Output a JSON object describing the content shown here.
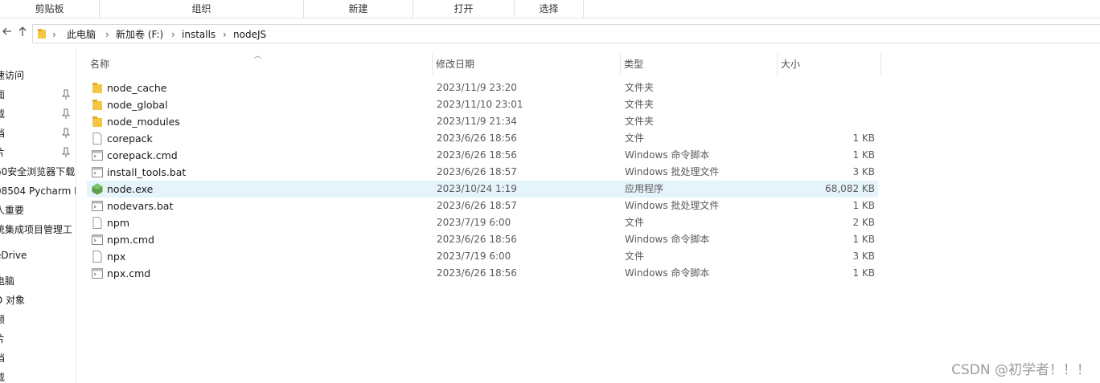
{
  "ribbon": {
    "groups": [
      "剪贴板",
      "组织",
      "新建",
      "打开",
      "选择"
    ]
  },
  "nav": {
    "back_icon": "arrow-left-icon",
    "up_icon": "arrow-up-icon"
  },
  "address": {
    "crumbs": [
      "此电脑",
      "新加卷 (F:)",
      "installs",
      "nodeJS"
    ]
  },
  "sidebar": {
    "items": [
      {
        "label": "速访问",
        "pinned": false
      },
      {
        "label": "面",
        "pinned": true
      },
      {
        "label": "载",
        "pinned": true
      },
      {
        "label": "档",
        "pinned": true
      },
      {
        "label": "片",
        "pinned": true
      },
      {
        "label": "60安全浏览器下载",
        "pinned": false
      },
      {
        "label": "08504 Pycharm P",
        "pinned": false
      },
      {
        "label": "人重要",
        "pinned": false
      },
      {
        "label": "统集成项目管理工",
        "pinned": false
      },
      {
        "label": "eDrive",
        "pinned": false
      },
      {
        "label": "电脑",
        "pinned": false
      },
      {
        "label": "D 对象",
        "pinned": false
      },
      {
        "label": "频",
        "pinned": false
      },
      {
        "label": "片",
        "pinned": false
      },
      {
        "label": "档",
        "pinned": false
      },
      {
        "label": "载",
        "pinned": false
      }
    ]
  },
  "columns": {
    "name": "名称",
    "date": "修改日期",
    "type": "类型",
    "size": "大小"
  },
  "files": [
    {
      "name": "node_cache",
      "date": "2023/11/9 23:20",
      "type": "文件夹",
      "size": "",
      "icon": "folder-icon"
    },
    {
      "name": "node_global",
      "date": "2023/11/10 23:01",
      "type": "文件夹",
      "size": "",
      "icon": "folder-icon"
    },
    {
      "name": "node_modules",
      "date": "2023/11/9 21:34",
      "type": "文件夹",
      "size": "",
      "icon": "folder-icon"
    },
    {
      "name": "corepack",
      "date": "2023/6/26 18:56",
      "type": "文件",
      "size": "1 KB",
      "icon": "file-icon"
    },
    {
      "name": "corepack.cmd",
      "date": "2023/6/26 18:56",
      "type": "Windows 命令脚本",
      "size": "1 KB",
      "icon": "script-icon"
    },
    {
      "name": "install_tools.bat",
      "date": "2023/6/26 18:57",
      "type": "Windows 批处理文件",
      "size": "3 KB",
      "icon": "script-icon"
    },
    {
      "name": "node.exe",
      "date": "2023/10/24 1:19",
      "type": "应用程序",
      "size": "68,082 KB",
      "icon": "nodejs-icon"
    },
    {
      "name": "nodevars.bat",
      "date": "2023/6/26 18:57",
      "type": "Windows 批处理文件",
      "size": "1 KB",
      "icon": "script-icon"
    },
    {
      "name": "npm",
      "date": "2023/7/19 6:00",
      "type": "文件",
      "size": "2 KB",
      "icon": "file-icon"
    },
    {
      "name": "npm.cmd",
      "date": "2023/6/26 18:56",
      "type": "Windows 命令脚本",
      "size": "1 KB",
      "icon": "script-icon"
    },
    {
      "name": "npx",
      "date": "2023/7/19 6:00",
      "type": "文件",
      "size": "3 KB",
      "icon": "file-icon"
    },
    {
      "name": "npx.cmd",
      "date": "2023/6/26 18:56",
      "type": "Windows 命令脚本",
      "size": "1 KB",
      "icon": "script-icon"
    }
  ],
  "selected_file": "node.exe",
  "watermark": "CSDN @初学者！！！",
  "colors": {
    "selection": "#e5f3fb",
    "folder": "#f4c642",
    "node_green": "#5fa04e"
  }
}
